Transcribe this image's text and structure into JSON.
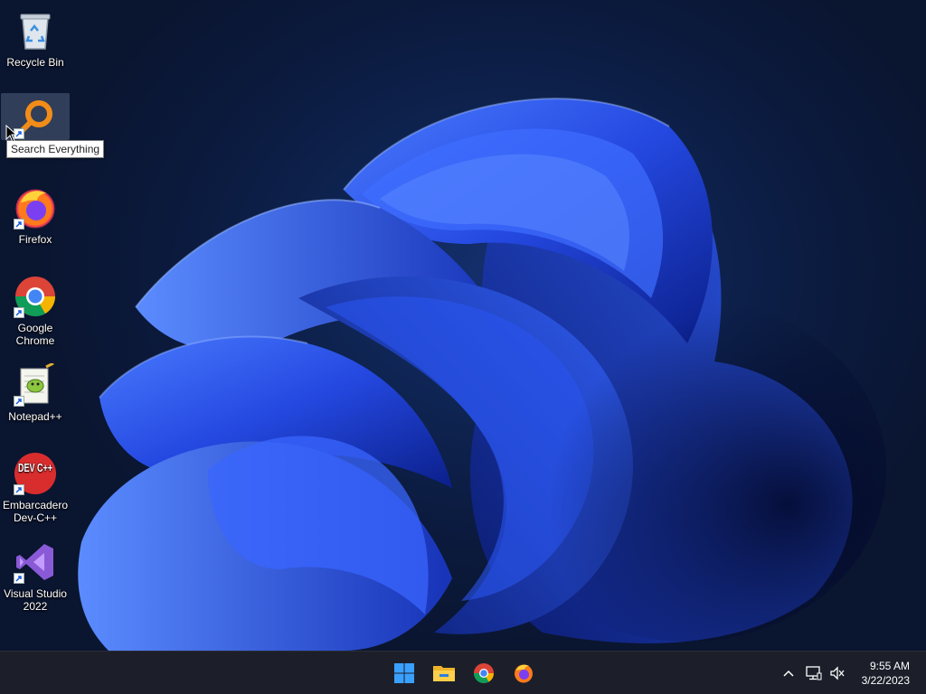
{
  "desktop": {
    "icons": [
      {
        "name": "recycle-bin",
        "label": "Recycle Bin"
      },
      {
        "name": "search-everything",
        "label": ""
      },
      {
        "name": "firefox",
        "label": "Firefox"
      },
      {
        "name": "google-chrome",
        "label": "Google Chrome"
      },
      {
        "name": "notepadpp",
        "label": "Notepad++"
      },
      {
        "name": "dev-cpp",
        "label": "Embarcadero Dev-C++"
      },
      {
        "name": "visual-studio",
        "label": "Visual Studio 2022"
      }
    ],
    "tooltip": "Search Everything",
    "devcpp_icon_text": "DEV C++"
  },
  "taskbar": {
    "pinned": [
      {
        "name": "start-button",
        "icon": "windows-logo-icon"
      },
      {
        "name": "file-explorer-button",
        "icon": "folder-icon"
      },
      {
        "name": "chrome-button",
        "icon": "chrome-icon"
      },
      {
        "name": "firefox-button",
        "icon": "firefox-icon"
      }
    ],
    "tray": {
      "icons": [
        "chevron-up-icon",
        "network-icon",
        "speaker-muted-icon"
      ]
    },
    "clock": {
      "time": "9:55 AM",
      "date": "3/22/2023"
    }
  },
  "colors": {
    "taskbar": "#1c1f2a",
    "wallpaper_bloom": "#2a5cff",
    "desktop_bg": "#0a1530"
  }
}
